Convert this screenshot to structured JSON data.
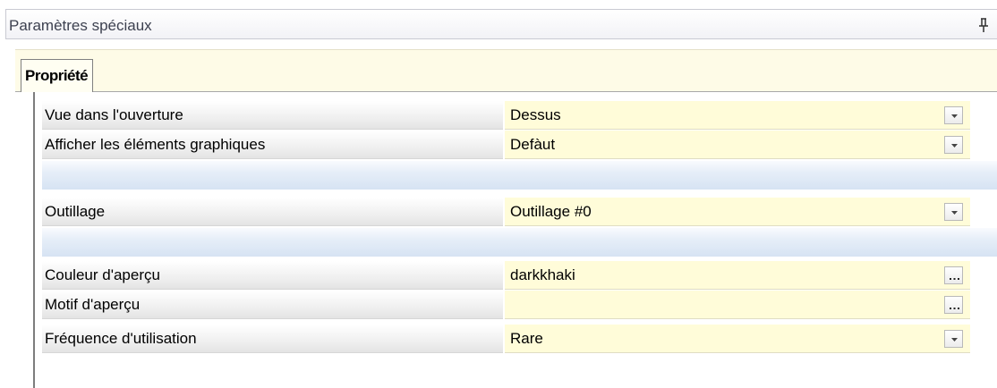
{
  "panel": {
    "title": "Paramètres spéciaux"
  },
  "tabs": [
    {
      "label": "Propriété",
      "active": true
    }
  ],
  "properties": [
    {
      "label": "Vue dans l'ouverture",
      "value": "Dessus",
      "editor": "dropdown"
    },
    {
      "label": "Afficher les éléments graphiques",
      "value": "Defàut",
      "editor": "dropdown"
    },
    {
      "label": "Outillage",
      "value": "Outillage #0",
      "editor": "dropdown"
    },
    {
      "label": "Couleur d'aperçu",
      "value": "darkkhaki",
      "editor": "ellipsis"
    },
    {
      "label": "Motif d'aperçu",
      "value": "",
      "editor": "ellipsis"
    },
    {
      "label": "Fréquence d'utilisation",
      "value": "Rare",
      "editor": "dropdown"
    }
  ],
  "icons": {
    "pin": "pin-icon",
    "dropdown": "chevron-down-icon",
    "ellipsis": "ellipsis-icon"
  },
  "colors": {
    "value_cell_bg": "#fffcd9",
    "tab_row_bg": "#fefbe7",
    "category_separator": "#d6e3f3"
  }
}
